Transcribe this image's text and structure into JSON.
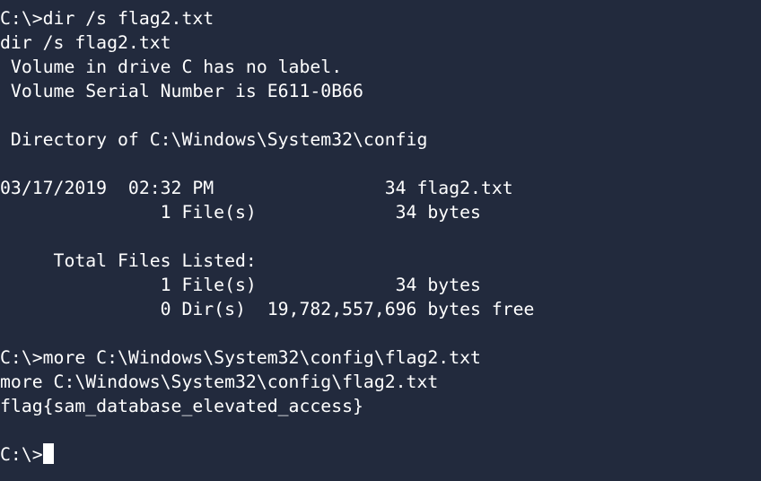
{
  "terminal": {
    "lines": [
      "C:\\>dir /s flag2.txt",
      "dir /s flag2.txt",
      " Volume in drive C has no label.",
      " Volume Serial Number is E611-0B66",
      "",
      " Directory of C:\\Windows\\System32\\config",
      "",
      "03/17/2019  02:32 PM                34 flag2.txt",
      "               1 File(s)             34 bytes",
      "",
      "     Total Files Listed:",
      "               1 File(s)             34 bytes",
      "               0 Dir(s)  19,782,557,696 bytes free",
      "",
      "C:\\>more C:\\Windows\\System32\\config\\flag2.txt",
      "more C:\\Windows\\System32\\config\\flag2.txt",
      "flag{sam_database_elevated_access}",
      "",
      "C:\\>"
    ]
  },
  "colors": {
    "background": "#222a3d",
    "text": "#ffffff"
  }
}
